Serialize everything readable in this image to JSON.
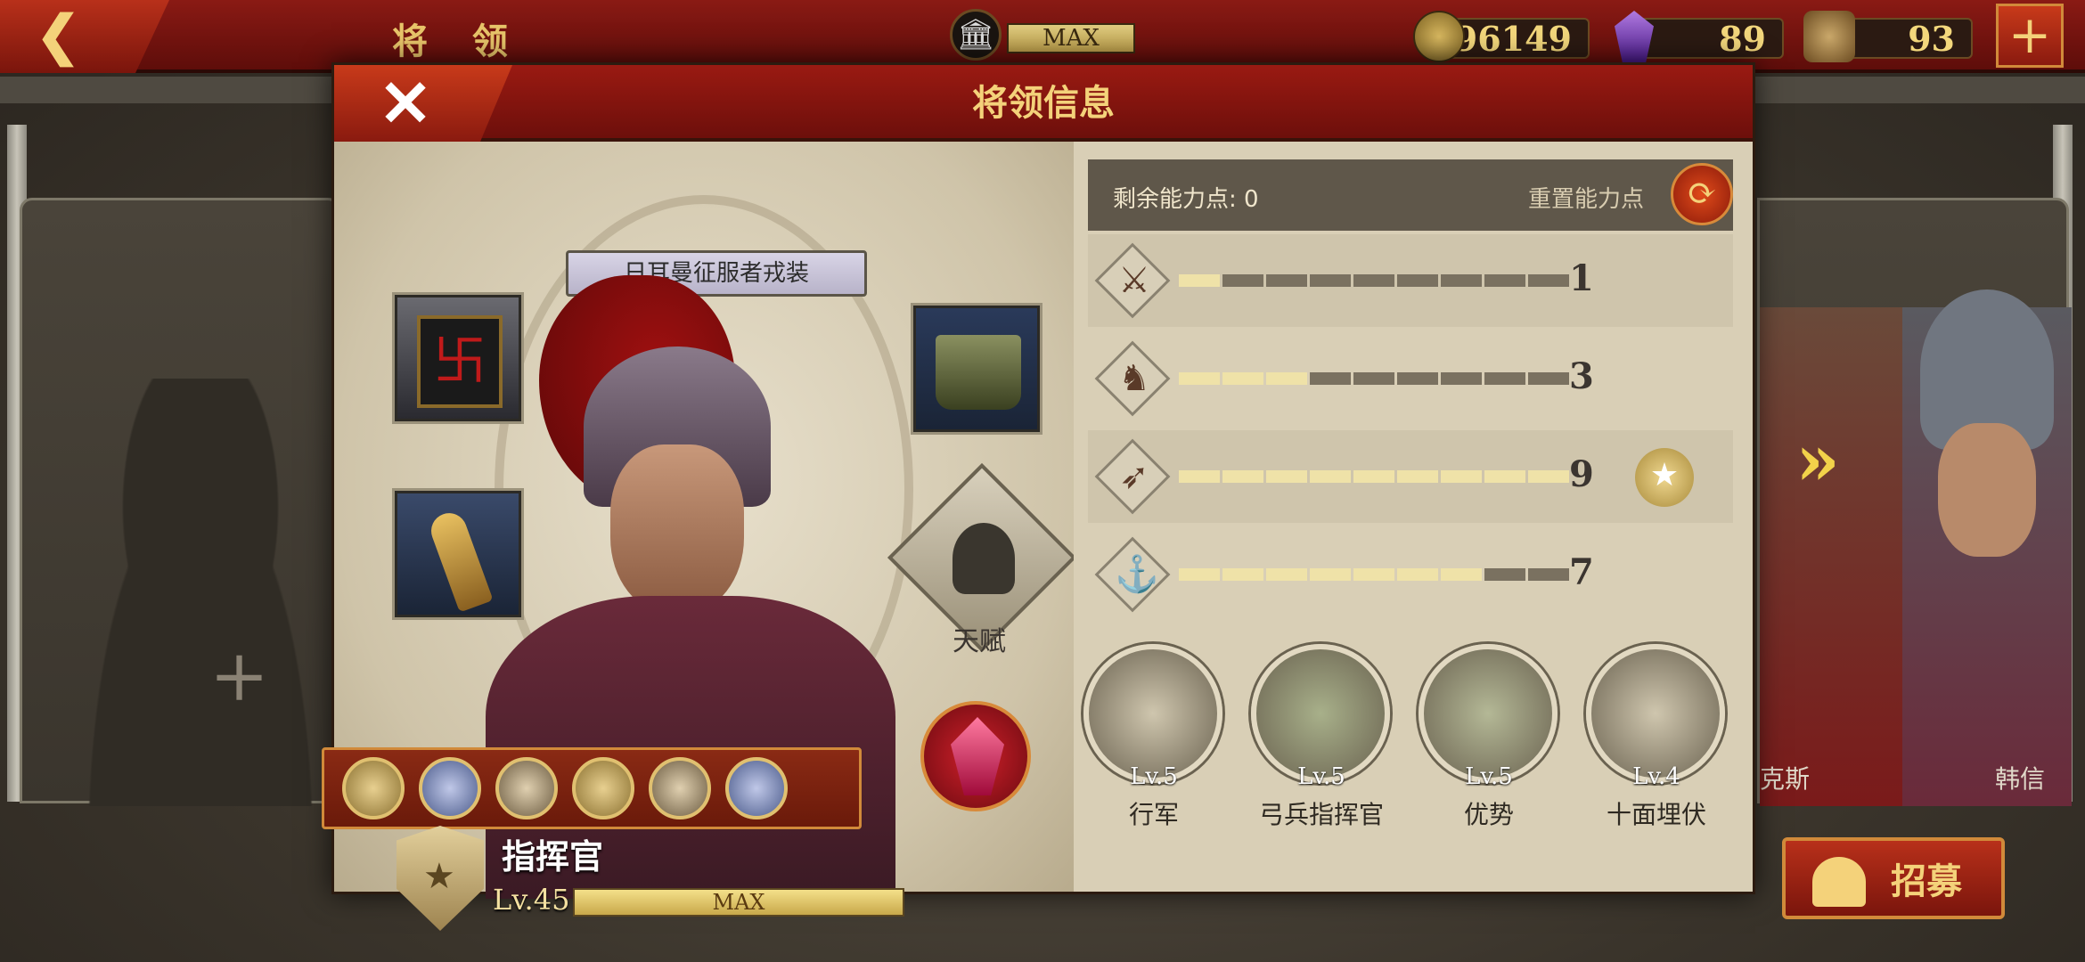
{
  "topbar": {
    "title": "将 领",
    "building_level": "MAX",
    "gold": "96149",
    "gems": "89",
    "medals": "93"
  },
  "dialog": {
    "title": "将领信息",
    "skin_label": "日耳曼征服者戎装",
    "talent_label": "天赋",
    "rank_name": "指挥官",
    "level_text": "Lv.45",
    "level_bar_text": "MAX",
    "points_label": "剩余能力点: 0",
    "reset_label": "重置能力点",
    "stats": [
      {
        "name": "infantry",
        "icon": "sword-icon",
        "value": "1",
        "filled": 1
      },
      {
        "name": "cavalry",
        "icon": "horse-icon",
        "value": "3",
        "filled": 3
      },
      {
        "name": "archer",
        "icon": "bow-icon",
        "value": "9",
        "filled": 9
      },
      {
        "name": "navy",
        "icon": "anchor-icon",
        "value": "7",
        "filled": 7
      }
    ],
    "skills": [
      {
        "level": "Lv.5",
        "name": "行军"
      },
      {
        "level": "Lv.5",
        "name": "弓兵指挥官"
      },
      {
        "level": "Lv.5",
        "name": "优势"
      },
      {
        "level": "Lv.4",
        "name": "十面埋伏"
      }
    ]
  },
  "side": {
    "right_general_1": "克斯",
    "right_general_2": "韩信"
  },
  "recruit_label": "招募",
  "colors": {
    "accent_gold": "#f4d27a",
    "header_red": "#8a1a14",
    "bar_fill": "#efe2a8",
    "bar_empty": "#7a7160"
  }
}
